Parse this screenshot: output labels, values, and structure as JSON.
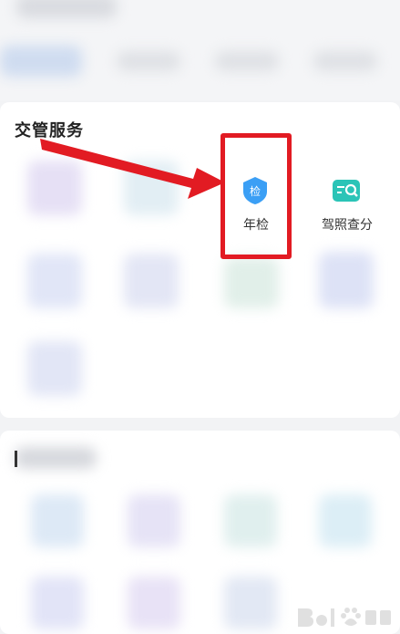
{
  "section": {
    "title": "交管服务"
  },
  "services": [
    {
      "label": "年检",
      "icon": "shield-check-icon",
      "icon_text": "检",
      "color": "#3b9ff5"
    },
    {
      "label": "驾照查分",
      "icon": "license-search-icon",
      "color": "#2bc4b7"
    }
  ],
  "colors": {
    "highlight": "#e21b23",
    "background": "#f2f3f5",
    "card": "#ffffff"
  }
}
